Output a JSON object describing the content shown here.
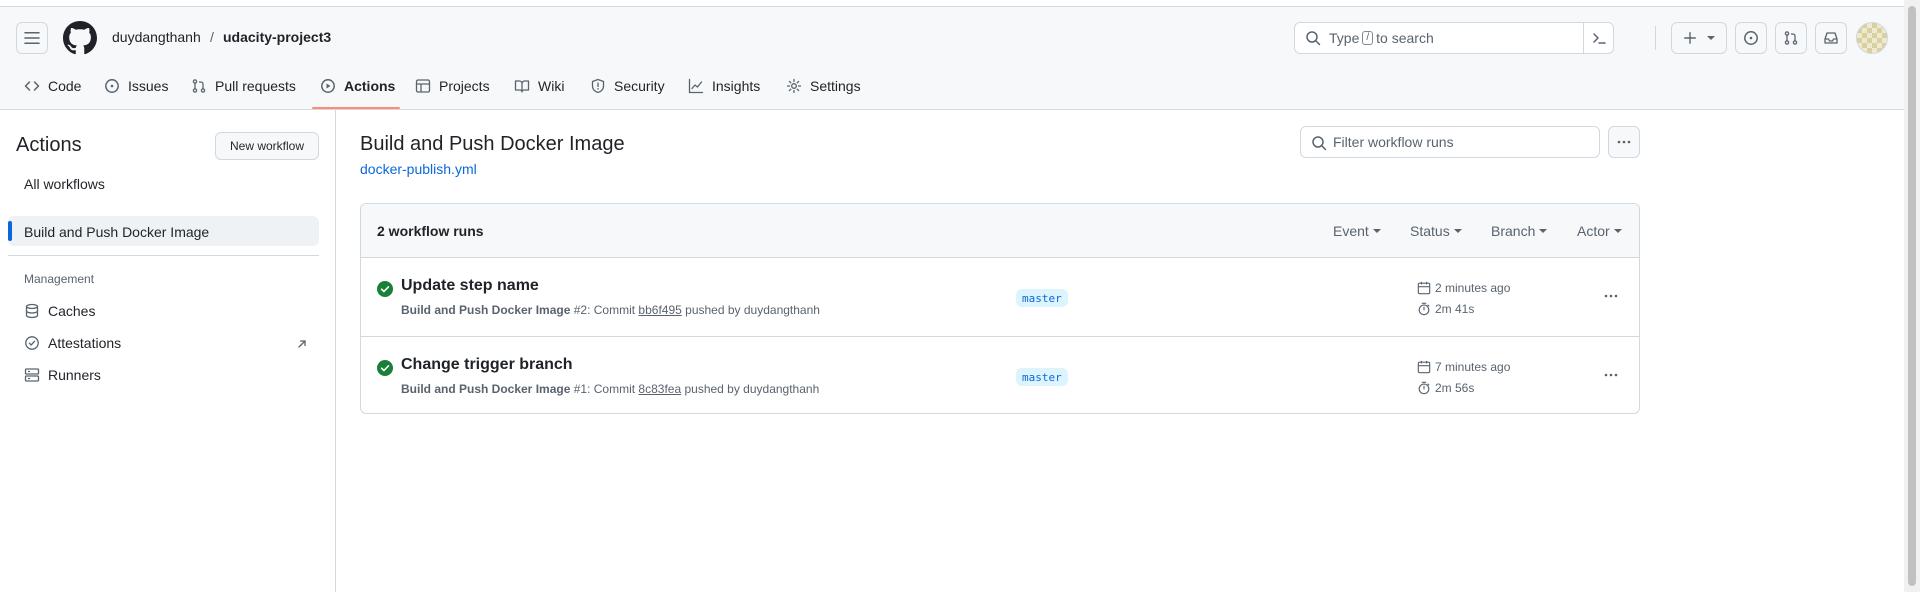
{
  "header": {
    "owner": "duydangthanh",
    "separator": "/",
    "repo": "udacity-project3",
    "search": {
      "prefix": "Type",
      "key": "/",
      "suffix": "to search"
    }
  },
  "nav": {
    "tabs": [
      {
        "label": "Code",
        "icon": "code-icon"
      },
      {
        "label": "Issues",
        "icon": "issue-icon"
      },
      {
        "label": "Pull requests",
        "icon": "pull-request-icon"
      },
      {
        "label": "Actions",
        "icon": "play-icon",
        "active": true
      },
      {
        "label": "Projects",
        "icon": "table-icon"
      },
      {
        "label": "Wiki",
        "icon": "book-icon"
      },
      {
        "label": "Security",
        "icon": "shield-icon"
      },
      {
        "label": "Insights",
        "icon": "graph-icon"
      },
      {
        "label": "Settings",
        "icon": "gear-icon"
      }
    ]
  },
  "sidebar": {
    "title": "Actions",
    "new_workflow": "New workflow",
    "all_workflows": "All workflows",
    "active_workflow": "Build and Push Docker Image",
    "management_heading": "Management",
    "management_items": [
      {
        "label": "Caches",
        "icon": "database-icon"
      },
      {
        "label": "Attestations",
        "icon": "verified-icon"
      },
      {
        "label": "Runners",
        "icon": "server-icon"
      }
    ]
  },
  "main": {
    "title": "Build and Push Docker Image",
    "file": "docker-publish.yml",
    "filter_placeholder": "Filter workflow runs",
    "run_count": "2 workflow runs",
    "filters": [
      "Event",
      "Status",
      "Branch",
      "Actor"
    ],
    "runs": [
      {
        "title": "Update step name",
        "workflow": "Build and Push Docker Image",
        "number": "#2",
        "commit_prefix": ": Commit",
        "sha": "bb6f495",
        "pushed_by": "pushed by duydangthanh",
        "branch": "master",
        "when": "2 minutes ago",
        "duration": "2m 41s",
        "status": "success"
      },
      {
        "title": "Change trigger branch",
        "workflow": "Build and Push Docker Image",
        "number": "#1",
        "commit_prefix": ": Commit",
        "sha": "8c83fea",
        "pushed_by": "pushed by duydangthanh",
        "branch": "master",
        "when": "7 minutes ago",
        "duration": "2m 56s",
        "status": "success"
      }
    ]
  },
  "colors": {
    "accent": "#0969da",
    "success": "#1a7f37",
    "tab_underline": "#fd8c73"
  }
}
